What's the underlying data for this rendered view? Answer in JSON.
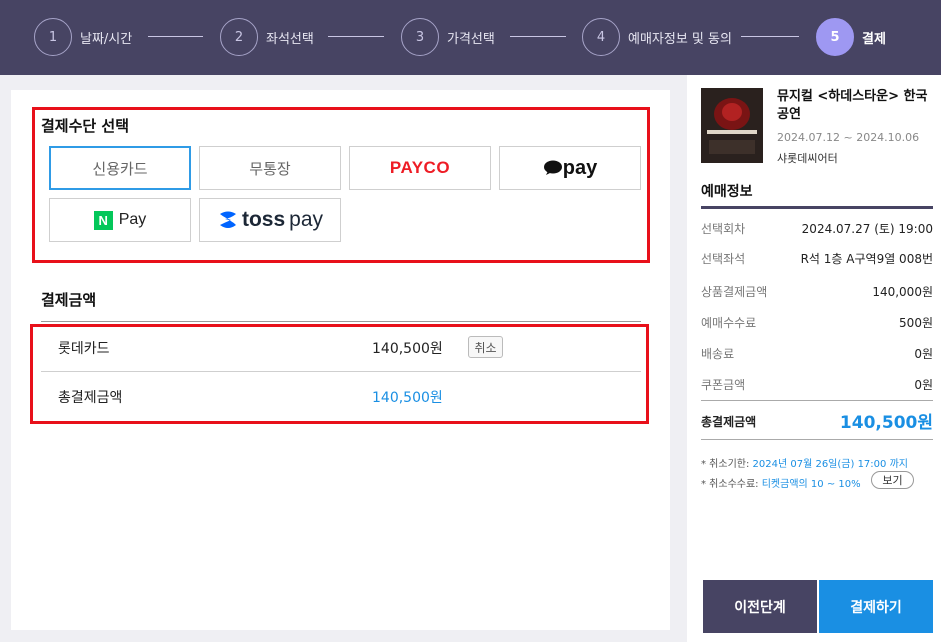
{
  "steps": [
    {
      "num": "1",
      "label": "날짜/시간"
    },
    {
      "num": "2",
      "label": "좌석선택"
    },
    {
      "num": "3",
      "label": "가격선택"
    },
    {
      "num": "4",
      "label": "예매자정보 및 동의"
    },
    {
      "num": "5",
      "label": "결제"
    }
  ],
  "payment_method": {
    "title": "결제수단 선택",
    "options": {
      "credit_card": "신용카드",
      "bank_transfer": "무통장",
      "payco": "PAYCO",
      "kakaopay": "pay",
      "naverpay_n": "N",
      "naverpay": "Pay",
      "toss_bold": "toss",
      "toss": "pay"
    },
    "selected": "신용카드"
  },
  "payment_amount": {
    "title": "결제금액",
    "card_label": "롯데카드",
    "card_amount": "140,500원",
    "cancel_label": "취소",
    "total_label": "총결제금액",
    "total_amount": "140,500원"
  },
  "sidebar": {
    "show_title": "뮤지컬 <하데스타운> 한국 공연",
    "show_dates": "2024.07.12 ~ 2024.10.06",
    "venue": "샤롯데씨어터",
    "info_title": "예매정보",
    "rows": [
      {
        "label": "선택회차",
        "value": "2024.07.27 (토) 19:00"
      },
      {
        "label": "선택좌석",
        "value": "R석 1층 A구역9열 008번"
      },
      {
        "label": "상품결제금액",
        "value": "140,000원"
      },
      {
        "label": "예매수수료",
        "value": "500원"
      },
      {
        "label": "배송료",
        "value": "0원"
      },
      {
        "label": "쿠폰금액",
        "value": "0원"
      }
    ],
    "total_label": "총결제금액",
    "total_value": "140,500원",
    "note1_prefix": "* 취소기한: ",
    "note1_value": "2024년 07월 26일(금) 17:00 까지",
    "note2_prefix": "* 취소수수료: ",
    "note2_value": "티켓금액의 10 ~ 10%",
    "view_label": "보기",
    "prev_label": "이전단계",
    "pay_label": "결제하기"
  },
  "colors": {
    "header": "#474463",
    "active_step": "#9e98f2",
    "accent": "#1a8fe3",
    "highlight": "#e8101a"
  }
}
